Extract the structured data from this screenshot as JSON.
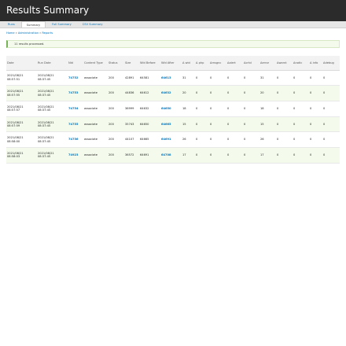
{
  "page": {
    "title": "Results Summary"
  },
  "tabs": [
    {
      "label": "Runs"
    },
    {
      "label": "Summary"
    },
    {
      "label": "Full Summary"
    },
    {
      "label": "CSV Summary"
    }
  ],
  "breadcrumb": [
    {
      "label": "Home"
    },
    {
      "sep": "»"
    },
    {
      "label": "Administration"
    },
    {
      "sep2": "»"
    },
    {
      "label": "Reports"
    }
  ],
  "message": "11 results processed.",
  "table": {
    "headers": [
      "Date",
      "Run Date",
      "Nid",
      "Content Type",
      "Status",
      "Size",
      "Wid Before",
      "Wid After",
      "Δ wid",
      "Δ php",
      "Δmsgnc",
      "Δalert",
      "Δcrtcl",
      "Δerror",
      "Δwarnt",
      "Δnotic",
      "Δ info",
      "Δdebug"
    ],
    "rows": [
      [
        "2021/08/21 08:57:51",
        "2021/08/21 08:37:45",
        "74752",
        "associate",
        "200",
        "42891",
        "64581",
        "64613",
        "31",
        "0",
        "0",
        "0",
        "0",
        "31",
        "0",
        "0",
        "0",
        "0"
      ],
      [
        "2021/08/21 08:57:55",
        "2021/08/21 08:37:45",
        "74753",
        "associate",
        "200",
        "44836",
        "64612",
        "64632",
        "20",
        "0",
        "0",
        "0",
        "0",
        "20",
        "0",
        "0",
        "0",
        "0"
      ],
      [
        "2021/08/21 08:57:57",
        "2021/08/21 08:37:45",
        "74754",
        "associate",
        "200",
        "36999",
        "64632",
        "64650",
        "18",
        "0",
        "0",
        "0",
        "0",
        "18",
        "0",
        "0",
        "0",
        "0"
      ],
      [
        "2021/08/21 08:57:59",
        "2021/08/21 08:37:45",
        "74755",
        "associate",
        "200",
        "35743",
        "64650",
        "64665",
        "15",
        "0",
        "0",
        "0",
        "0",
        "15",
        "0",
        "0",
        "0",
        "0"
      ],
      [
        "2021/08/21 08:58:00",
        "2021/08/21 08:37:45",
        "74756",
        "associate",
        "200",
        "44107",
        "64665",
        "64691",
        "26",
        "0",
        "0",
        "0",
        "0",
        "26",
        "0",
        "0",
        "0",
        "0"
      ],
      [
        "2021/08/21 08:58:03",
        "2021/08/21 08:37:45",
        "74923",
        "associate",
        "200",
        "36572",
        "64691",
        "64708",
        "17",
        "0",
        "0",
        "0",
        "0",
        "17",
        "0",
        "0",
        "0",
        "0"
      ]
    ]
  }
}
